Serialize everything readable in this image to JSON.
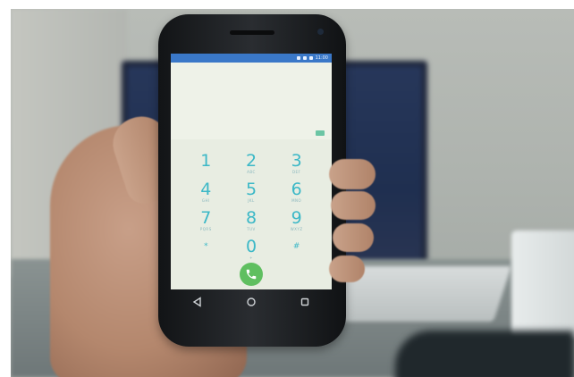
{
  "status_bar": {
    "time": "11:00"
  },
  "dialer": {
    "keys": [
      {
        "digit": "1",
        "letters": ""
      },
      {
        "digit": "2",
        "letters": "ABC"
      },
      {
        "digit": "3",
        "letters": "DEF"
      },
      {
        "digit": "4",
        "letters": "GHI"
      },
      {
        "digit": "5",
        "letters": "JKL"
      },
      {
        "digit": "6",
        "letters": "MNO"
      },
      {
        "digit": "7",
        "letters": "PQRS"
      },
      {
        "digit": "8",
        "letters": "TUV"
      },
      {
        "digit": "9",
        "letters": "WXYZ"
      },
      {
        "digit": "*",
        "letters": ""
      },
      {
        "digit": "0",
        "letters": "+"
      },
      {
        "digit": "#",
        "letters": ""
      }
    ],
    "call_icon": "phone-icon",
    "backspace_icon": "backspace-icon"
  },
  "nav": {
    "back_icon": "back-triangle-icon",
    "home_icon": "home-circle-icon",
    "recents_icon": "recents-square-icon"
  },
  "colors": {
    "status_bar": "#3a78c8",
    "digit": "#3cb8c7",
    "call_button": "#5fbf60",
    "screen_bg": "#e8ede2"
  }
}
